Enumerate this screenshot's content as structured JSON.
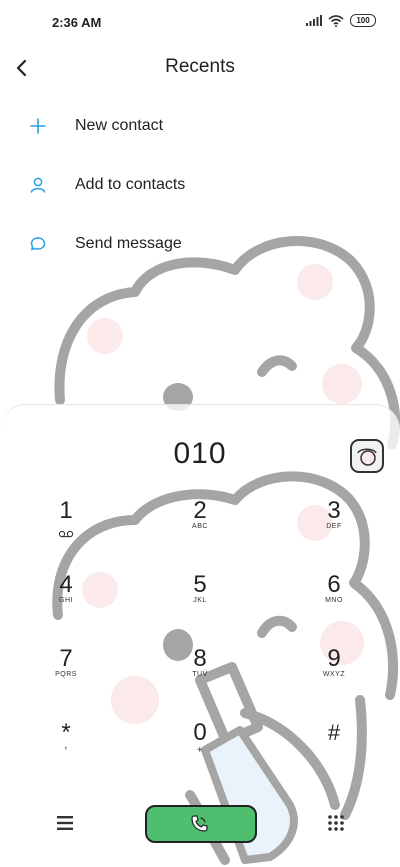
{
  "status_bar": {
    "time": "2:36 AM",
    "battery": "100"
  },
  "header": {
    "title": "Recents"
  },
  "actions": [
    {
      "label": "New contact",
      "icon": "plus-icon"
    },
    {
      "label": "Add to contacts",
      "icon": "person-icon"
    },
    {
      "label": "Send message",
      "icon": "message-icon"
    }
  ],
  "dialer": {
    "number": "010",
    "keys": [
      {
        "digit": "1",
        "letters": ""
      },
      {
        "digit": "2",
        "letters": "ABC"
      },
      {
        "digit": "3",
        "letters": "DEF"
      },
      {
        "digit": "4",
        "letters": "GHI"
      },
      {
        "digit": "5",
        "letters": "JKL"
      },
      {
        "digit": "6",
        "letters": "MNO"
      },
      {
        "digit": "7",
        "letters": "PQRS"
      },
      {
        "digit": "8",
        "letters": "TUV"
      },
      {
        "digit": "9",
        "letters": "WXYZ"
      },
      {
        "digit": "*",
        "letters": ","
      },
      {
        "digit": "0",
        "letters": "+"
      },
      {
        "digit": "#",
        "letters": ""
      }
    ]
  },
  "colors": {
    "accent": "#2aa0e6",
    "call": "#4fbe6e",
    "outline": "#9c9c9c"
  }
}
